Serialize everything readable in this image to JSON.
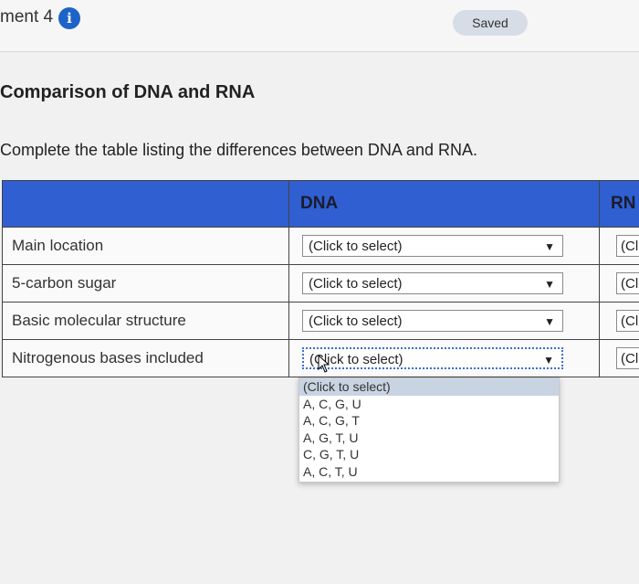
{
  "header": {
    "assignment_title": "ment 4",
    "info_icon": "info-icon",
    "saved_label": "Saved"
  },
  "question": {
    "heading": "Comparison of DNA and RNA",
    "instructions": "Complete the table listing the differences between DNA and RNA."
  },
  "table": {
    "columns": [
      "",
      "DNA",
      "RN"
    ],
    "rows": [
      {
        "label": "Main location",
        "dna_select": "(Click to select)",
        "rna_select": "(Cli"
      },
      {
        "label": "5-carbon sugar",
        "dna_select": "(Click to select)",
        "rna_select": "(Cli"
      },
      {
        "label": "Basic molecular structure",
        "dna_select": "(Click to select)",
        "rna_select": "(Clic"
      },
      {
        "label": "Nitrogenous bases included",
        "dna_select": "(Click to select)",
        "rna_select": "(Clic"
      }
    ]
  },
  "dropdown": {
    "options": [
      "(Click to select)",
      "A, C, G, U",
      "A, C, G, T",
      "A, G, T, U",
      "C, G, T, U",
      "A, C, T, U"
    ],
    "highlighted_index": 0
  },
  "colors": {
    "header_blue": "#2f5fd0",
    "info_blue": "#1e63c7",
    "saved_pill": "#d6dde6"
  }
}
